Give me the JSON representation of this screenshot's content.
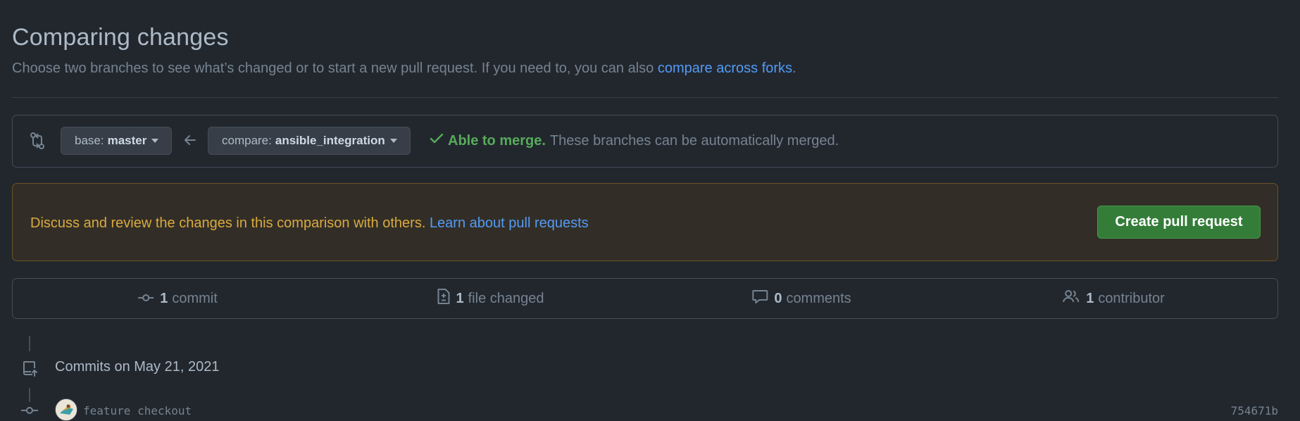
{
  "header": {
    "title": "Comparing changes",
    "subtitle": "Choose two branches to see what’s changed or to start a new pull request. If you need to, you can also ",
    "subtitle_link": "compare across forks",
    "subtitle_end": "."
  },
  "range": {
    "icon": "git-compare-icon",
    "base_prefix": "base:",
    "base_branch": "master",
    "compare_prefix": "compare:",
    "compare_branch": "ansible_integration",
    "merge_ok": "Able to merge.",
    "merge_desc": "These branches can be automatically merged."
  },
  "flash": {
    "text": "Discuss and review the changes in this comparison with others. ",
    "link": "Learn about pull requests",
    "button": "Create pull request"
  },
  "summary": {
    "commits_count": "1",
    "commits_label": "commit",
    "files_count": "1",
    "files_label": "file changed",
    "comments_count": "0",
    "comments_label": "comments",
    "contributors_count": "1",
    "contributors_label": "contributor"
  },
  "timeline": {
    "date_heading": "Commits on May 21, 2021",
    "commits": [
      {
        "message": "feature checkout",
        "sha": "754671b"
      }
    ]
  },
  "colors": {
    "background": "#22272e",
    "link": "#539bf5",
    "success": "#57ab5a",
    "warning_text": "#daaa3f",
    "button_green": "#347d39"
  }
}
